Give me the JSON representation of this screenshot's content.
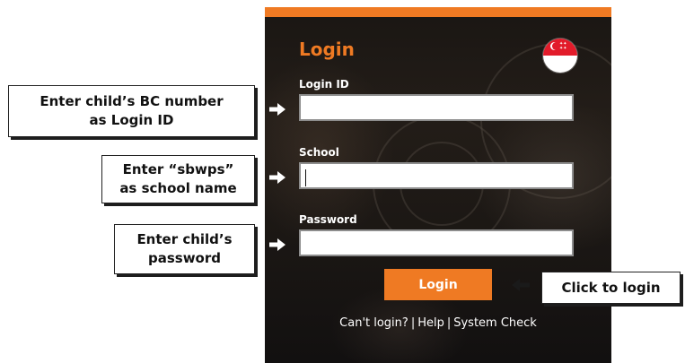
{
  "login_panel": {
    "title": "Login",
    "fields": [
      {
        "label": "Login ID",
        "value": "",
        "placeholder": ""
      },
      {
        "label": "School",
        "value": "",
        "placeholder": ""
      },
      {
        "label": "Password",
        "value": "",
        "placeholder": ""
      }
    ],
    "login_button": "Login",
    "footer": {
      "cant_login": "Can't login?",
      "help": "Help",
      "system_check": "System Check",
      "separator": "|"
    },
    "flag_icon": "singapore-flag-icon",
    "accent_color": "#ef7a23"
  },
  "annotations": {
    "login_id": [
      "Enter child’s BC number",
      "as Login ID"
    ],
    "school": [
      "Enter “sbwps”",
      "as school name"
    ],
    "password": [
      "Enter child’s",
      "password"
    ],
    "login": [
      "Click to login"
    ]
  }
}
